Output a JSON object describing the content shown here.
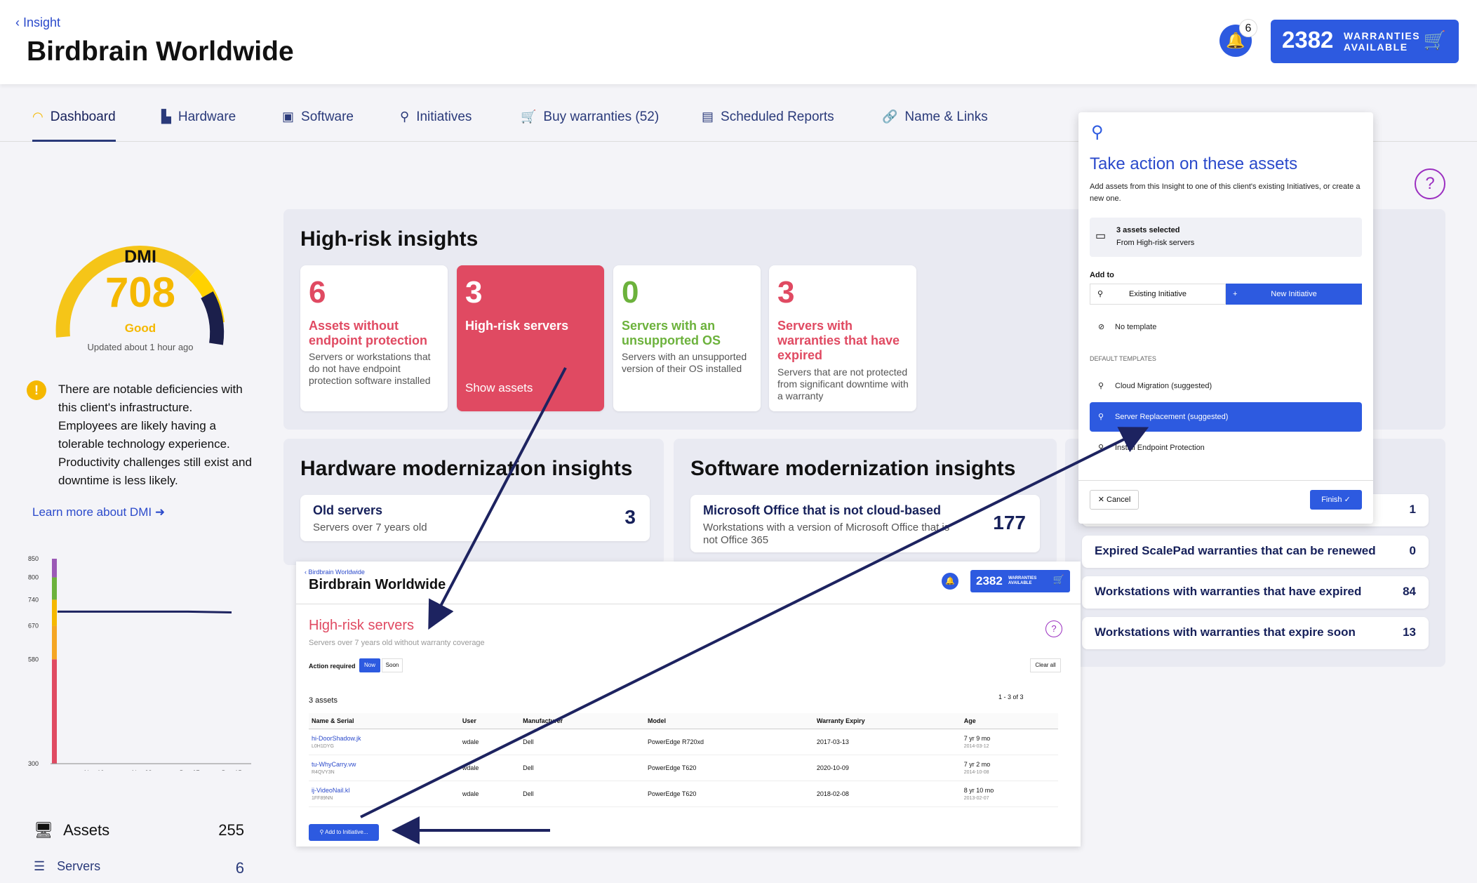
{
  "header": {
    "back_label": "Insight",
    "title": "Birdbrain Worldwide",
    "notif_count": "6",
    "warranties_count": "2382",
    "warranties_label_1": "WARRANTIES",
    "warranties_label_2": "AVAILABLE"
  },
  "tabs": [
    {
      "label": "Dashboard",
      "icon": "gauge-icon"
    },
    {
      "label": "Hardware",
      "icon": "hardware-icon"
    },
    {
      "label": "Software",
      "icon": "software-icon"
    },
    {
      "label": "Initiatives",
      "icon": "pin-icon"
    },
    {
      "label": "Buy warranties (52)",
      "icon": "cart-icon"
    },
    {
      "label": "Scheduled Reports",
      "icon": "document-icon"
    },
    {
      "label": "Name & Links",
      "icon": "link-icon"
    }
  ],
  "dmi": {
    "label": "DMI",
    "value": "708",
    "rating": "Good",
    "updated": "Updated about 1 hour ago",
    "gauge_level": 0.7,
    "message": "There are notable deficiencies with this client's infrastructure. Employees are likely having a tolerable technology experience. Productivity challenges still exist and downtime is less likely.",
    "learn_more": "Learn more about DMI"
  },
  "chart_data": {
    "type": "line",
    "yticks": [
      "850",
      "800",
      "740",
      "670",
      "580",
      "300"
    ],
    "xticks": [
      "Nov 19",
      "Nov 28",
      "Dec 07",
      "Dec 15"
    ],
    "y_values": [
      708,
      708,
      708,
      708,
      706
    ],
    "ylim": [
      300,
      850
    ]
  },
  "summary": {
    "assets_label": "Assets",
    "assets_value": "255",
    "servers_label": "Servers",
    "servers_value": "6"
  },
  "high_risk": {
    "title": "High-risk insights",
    "cards": [
      {
        "num": "6",
        "title": "Assets without endpoint protection",
        "desc": "Servers or workstations that do not have endpoint protection software installed"
      },
      {
        "num": "3",
        "title": "High-risk servers",
        "action": "Show assets"
      },
      {
        "num": "0",
        "title": "Servers with an unsupported OS",
        "desc": "Servers with an unsupported version of their OS installed"
      },
      {
        "num": "3",
        "title": "Servers with warranties that have expired",
        "desc": "Servers that are not protected from significant downtime with a warranty"
      }
    ]
  },
  "hardware": {
    "title": "Hardware modernization insights",
    "item_title": "Old servers",
    "item_desc": "Servers over 7 years old",
    "item_value": "3"
  },
  "software": {
    "title": "Software modernization insights",
    "item_title": "Microsoft Office that is not cloud-based",
    "item_desc": "Workstations with a version of Microsoft Office that is not Office 365",
    "item_value": "177"
  },
  "right_items": [
    {
      "title": "",
      "value": "1"
    },
    {
      "title": "Expired ScalePad warranties that can be renewed",
      "value": "0"
    },
    {
      "title": "Workstations with warranties that have expired",
      "value": "84"
    },
    {
      "title": "Workstations with warranties that expire soon",
      "value": "13"
    }
  ],
  "inset": {
    "back": "Birdbrain Worldwide",
    "title": "Birdbrain Worldwide",
    "warr": "2382",
    "section": "High-risk servers",
    "sub": "Servers over 7 years old without warranty coverage",
    "action_label": "Action required",
    "now": "Now",
    "soon": "Soon",
    "clear": "Clear all",
    "count": "3 assets",
    "pager": "1 - 3 of 3",
    "add_btn": "Add to Initiative...",
    "columns": [
      "Name & Serial",
      "User",
      "Manufacturer",
      "Model",
      "Warranty Expiry",
      "Age"
    ],
    "rows": [
      [
        "hi-DoorShadow.jk",
        "L0H1DYG",
        "wdale",
        "Dell",
        "PowerEdge R720xd",
        "2017-03-13",
        "7 yr 9 mo",
        "2014-03-12"
      ],
      [
        "tu-WhyCarry.vw",
        "R4QVY3N",
        "wdale",
        "Dell",
        "PowerEdge T620",
        "2020-10-09",
        "7 yr 2 mo",
        "2014-10-08"
      ],
      [
        "ij-VideoNail.kl",
        "1FF89NN",
        "wdale",
        "Dell",
        "PowerEdge T620",
        "2018-02-08",
        "8 yr 10 mo",
        "2013-02-07"
      ]
    ]
  },
  "modal": {
    "title": "Take action on these assets",
    "desc": "Add assets from this Insight to one of this client's existing Initiatives, or create a new one.",
    "selected": "3 assets selected",
    "selected_sub": "From High-risk servers",
    "add_to": "Add to",
    "existing": "Existing Initiative",
    "new": "New Initiative",
    "no_template": "No template",
    "default_templates": "DEFAULT TEMPLATES",
    "templates": [
      "Cloud Migration (suggested)",
      "Server Replacement (suggested)",
      "Install Endpoint Protection"
    ],
    "cancel": "Cancel",
    "finish": "Finish"
  },
  "colors": {
    "primary": "#2d5ae0",
    "navy": "#16205a",
    "red": "#e04a62",
    "green": "#6cb23c",
    "yellow": "#f5b800"
  }
}
